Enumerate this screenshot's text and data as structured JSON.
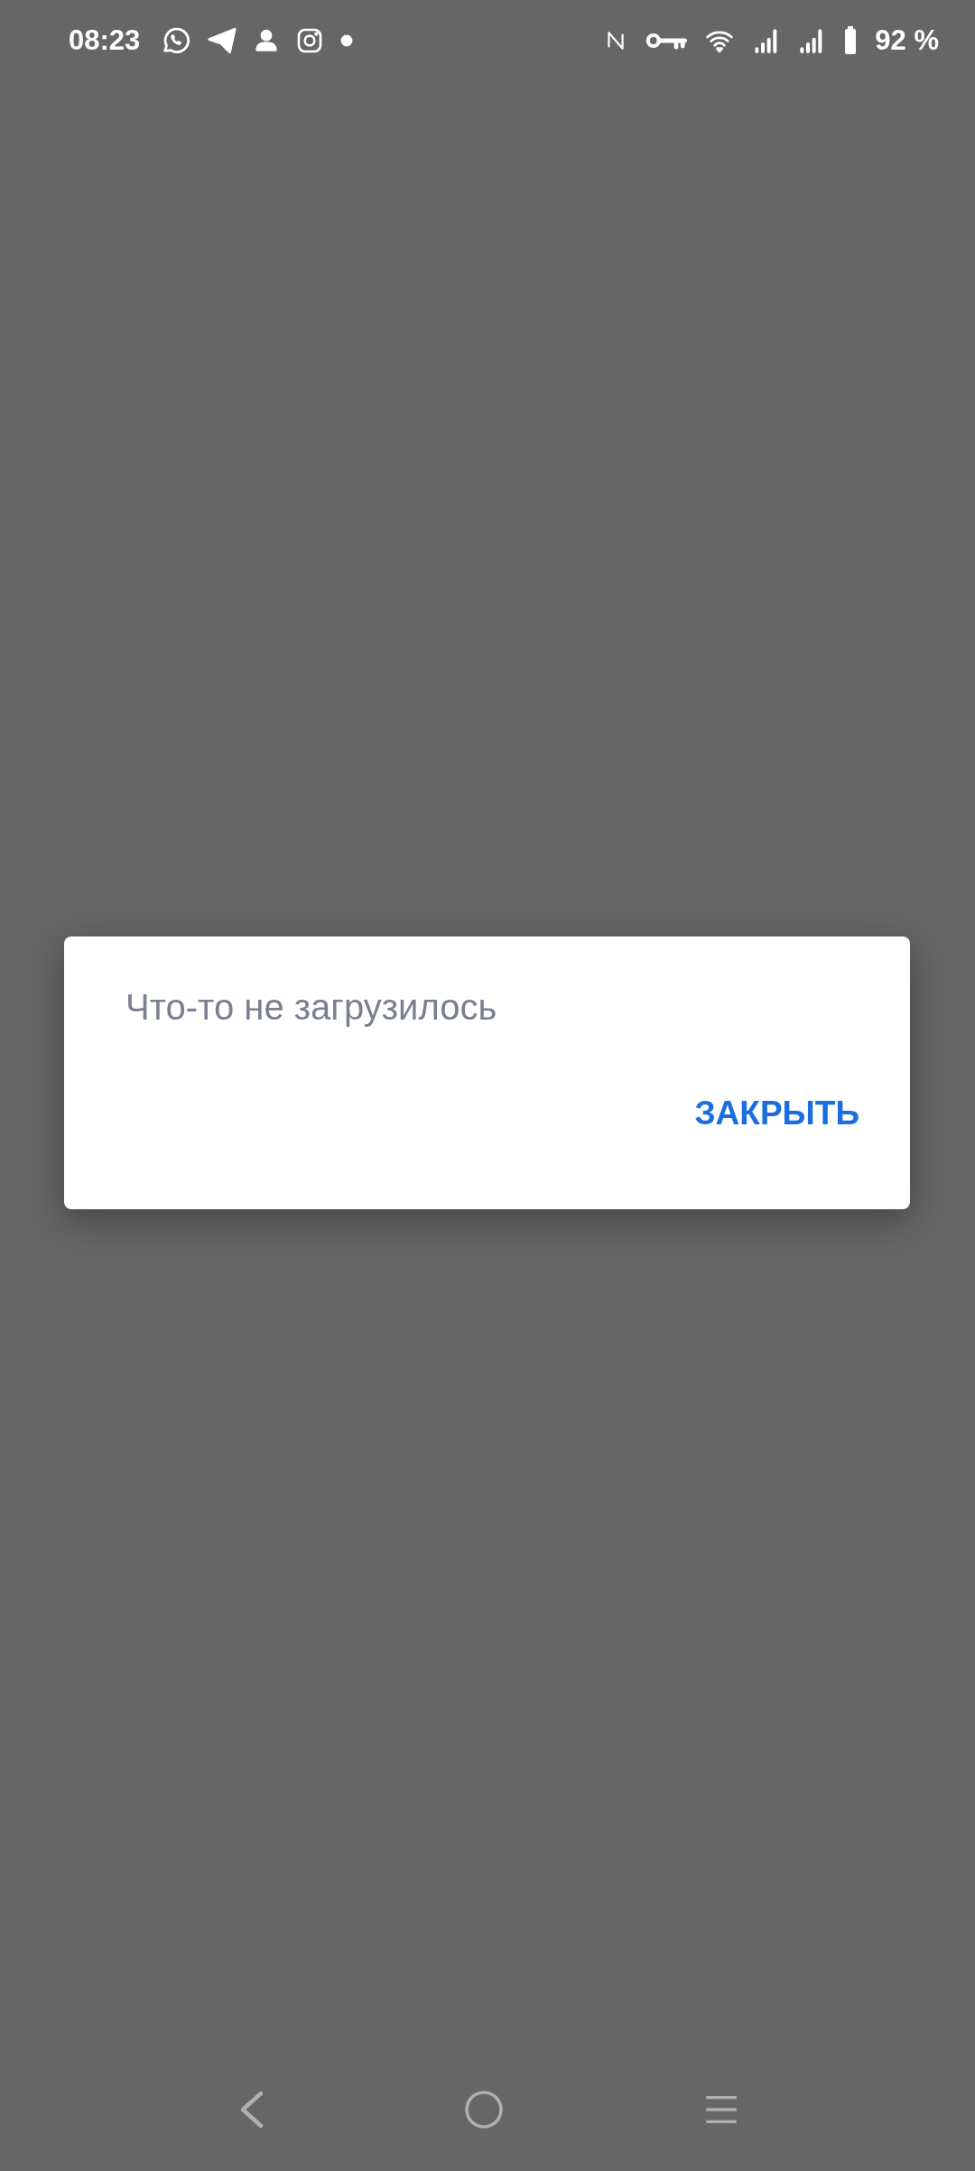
{
  "status_bar": {
    "time": "08:23",
    "battery": "92 %"
  },
  "dialog": {
    "message": "Что-то не загрузилось",
    "button": "ЗАКРЫТЬ"
  }
}
